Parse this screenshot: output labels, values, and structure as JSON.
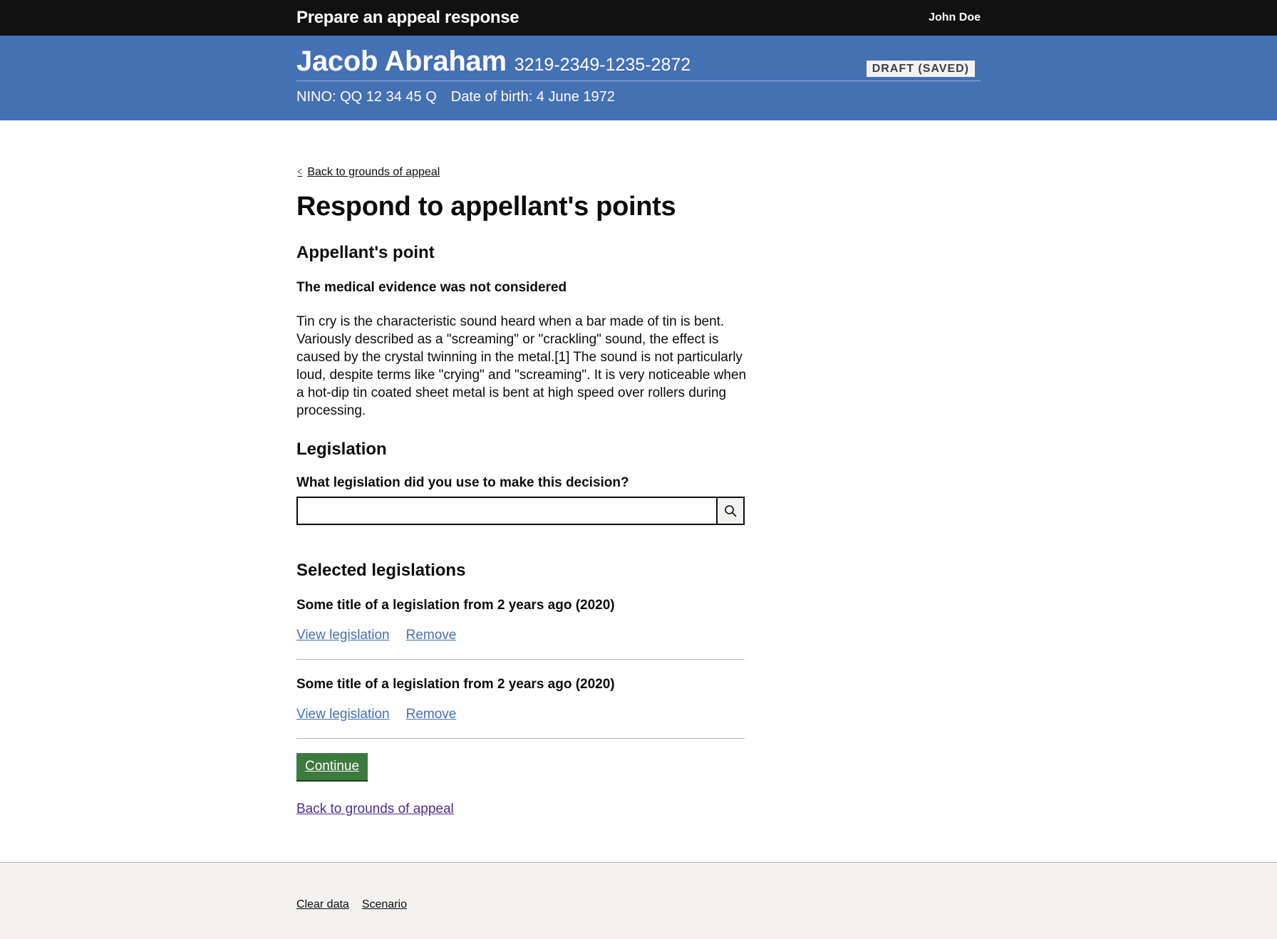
{
  "header": {
    "service_name": "Prepare an appeal response",
    "user_name": "John Doe"
  },
  "banner": {
    "person_name": "Jacob Abraham",
    "claim_ref": "3219-2349-1235-2872",
    "status_tag": "DRAFT (SAVED)",
    "nino": "NINO: QQ 12 34 45 Q",
    "dob": "Date of birth: 4 June 1972"
  },
  "nav": {
    "back_top": "Back to grounds of appeal",
    "back_bottom": "Back to grounds of appeal"
  },
  "page": {
    "title": "Respond to appellant's points",
    "point_heading": "Appellant's point",
    "point_title": "The medical evidence was not considered",
    "point_body": "Tin cry is the characteristic sound heard when a bar made of tin is bent. Variously described as a \"screaming\" or \"crackling\" sound, the effect is caused by the crystal twinning in the metal.[1] The sound is not particularly loud, despite terms like \"crying\" and \"screaming\". It is very noticeable when a hot-dip tin coated sheet metal is bent at high speed over rollers during processing."
  },
  "legislation": {
    "heading": "Legislation",
    "question": "What legislation did you use to make this decision?",
    "search_value": "",
    "search_icon": "search-icon"
  },
  "selected": {
    "heading": "Selected legislations",
    "items": [
      {
        "title": "Some title of a legislation from 2 years ago (2020)",
        "view_label": "View legislation",
        "remove_label": "Remove"
      },
      {
        "title": "Some title of a legislation from 2 years ago (2020)",
        "view_label": "View legislation",
        "remove_label": "Remove"
      }
    ]
  },
  "actions": {
    "continue_label": "Continue"
  },
  "footer": {
    "links": [
      "Clear data",
      "Scenario"
    ]
  },
  "colors": {
    "topbar": "#111111",
    "banner": "#4470b4",
    "continue": "#3d7a3d",
    "link": "#4470b4",
    "visited_link": "#4c2c92",
    "footer_bg": "#f3f2f1"
  }
}
